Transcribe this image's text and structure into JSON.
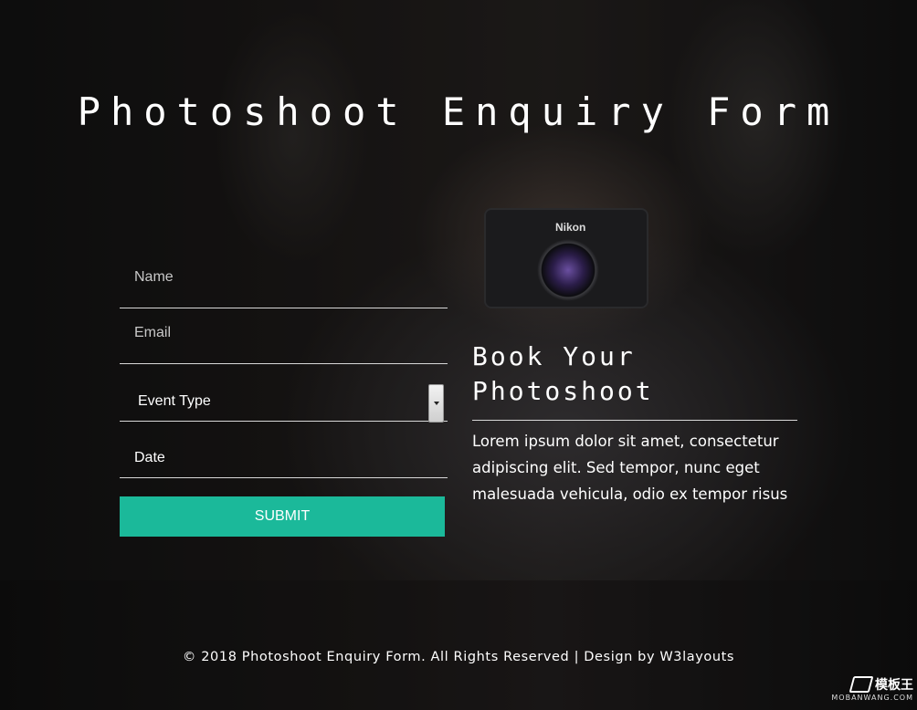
{
  "page": {
    "title": "Photoshoot Enquiry Form"
  },
  "form": {
    "name_placeholder": "Name",
    "email_placeholder": "Email",
    "event_type_selected": "Event Type",
    "date_placeholder": "Date",
    "submit_label": "SUBMIT"
  },
  "promo": {
    "heading_line1": "Book Your",
    "heading_line2": "Photoshoot",
    "body_line1": "Lorem ipsum dolor sit amet, consectetur",
    "body_line2": "adipiscing elit. Sed tempor, nunc eget",
    "body_line3": "malesuada vehicula, odio ex tempor risus"
  },
  "footer": {
    "text": "© 2018 Photoshoot Enquiry Form. All Rights Reserved | Design by W3layouts"
  },
  "watermark": {
    "title": "模板王",
    "subtitle": "MOBANWANG.COM"
  },
  "camera": {
    "brand": "Nikon"
  },
  "colors": {
    "accent": "#1bb99a",
    "text": "#ffffff"
  },
  "icons": {
    "select_arrow": "chevron-down-icon"
  }
}
